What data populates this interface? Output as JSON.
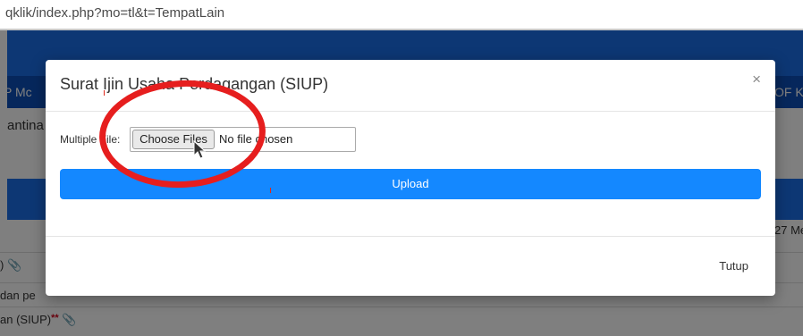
{
  "browser": {
    "url": "qklik/index.php?mo=tl&t=TempatLain"
  },
  "background_page": {
    "nav_left": "P Mc",
    "nav_right": "OF K",
    "title_partial": "antina",
    "date_partial": "27 Me",
    "rows": [
      {
        "text": ")",
        "required": false,
        "attachment": true
      },
      {
        "text": "dan pe",
        "required": false,
        "attachment": false
      },
      {
        "text": "an (SIUP)",
        "required": true,
        "attachment": true
      }
    ]
  },
  "modal": {
    "title": "Surat Ijin Usaha Perdagangan (SIUP)",
    "close_symbol": "×",
    "file_label": "Multiple File:",
    "choose_files_label": "Choose Files",
    "no_file_text": "No file chosen",
    "upload_label": "Upload",
    "close_button_label": "Tutup"
  },
  "required_marker": "**",
  "colors": {
    "header_blue": "#1a6fe8",
    "nav_blue": "#0c4fb8",
    "upload_blue": "#1488ff",
    "annotation_red": "#e61e1e"
  },
  "icons": [
    "paperclip-icon",
    "close-icon",
    "mouse-cursor-icon"
  ]
}
